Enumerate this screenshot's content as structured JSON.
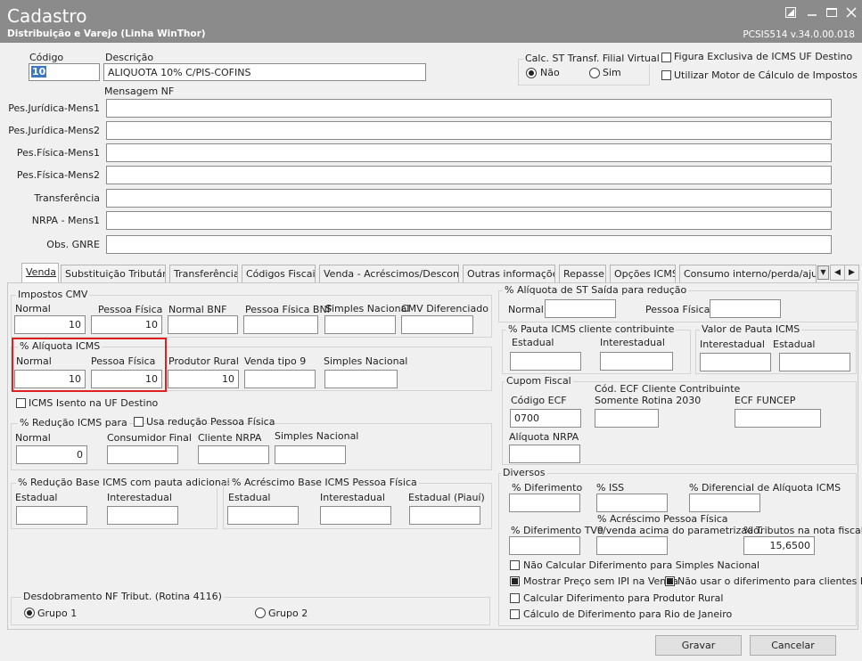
{
  "window": {
    "title": "Cadastro",
    "subtitle": "Distribuição e Varejo (Linha WinThor)",
    "version": "PCSIS514  v.34.0.00.018",
    "icons": [
      "restore-icon",
      "minimize-icon",
      "maximize-icon",
      "close-icon"
    ]
  },
  "header": {
    "codigo_label": "Código",
    "codigo_value": "10",
    "descricao_label": "Descrição",
    "descricao_value": "ALIQUOTA 10% C/PIS-COFINS",
    "mensagem_label": "Mensagem NF",
    "calc_st_title": "Calc. ST Transf. Filial Virtual",
    "calc_st_nao": "Não",
    "calc_st_sim": "Sim",
    "figura_exclusiva": "Figura Exclusiva de ICMS UF Destino",
    "utilizar_motor": "Utilizar Motor de Cálculo de Impostos"
  },
  "messages": [
    {
      "label": "Pes.Jurídica-Mens1",
      "value": ""
    },
    {
      "label": "Pes.Jurídica-Mens2",
      "value": ""
    },
    {
      "label": "Pes.Física-Mens1",
      "value": ""
    },
    {
      "label": "Pes.Física-Mens2",
      "value": ""
    },
    {
      "label": "Transferência",
      "value": ""
    },
    {
      "label": "NRPA - Mens1",
      "value": ""
    },
    {
      "label": "Obs. GNRE",
      "value": ""
    }
  ],
  "tabs": [
    "Venda",
    "Substituição Tributária",
    "Transferência",
    "Códigos Fiscais",
    "Venda - Acréscimos/Descontos",
    "Outras informações",
    "Repasse",
    "Opções ICMS",
    "Consumo interno/perda/ajuste"
  ],
  "impostos_cmv": {
    "title": "Impostos CMV",
    "normal_label": "Normal",
    "normal_value": "10",
    "pf_label": "Pessoa Física",
    "pf_value": "10",
    "bnf_label": "Normal BNF",
    "bnf_value": "",
    "pfbnf_label": "Pessoa Física BNF",
    "pfbnf_value": "",
    "simples_label": "Simples Nacional",
    "simples_value": "",
    "dif_label": "CMV Diferenciado",
    "dif_value": ""
  },
  "aliquota_icms": {
    "title": "% Alíquota ICMS",
    "normal_label": "Normal",
    "normal_value": "10",
    "pf_label": "Pessoa Física",
    "pf_value": "10",
    "produtor_label": "Produtor Rural",
    "produtor_value": "10",
    "venda9_label": "Venda tipo 9",
    "venda9_value": "",
    "simples_label": "Simples Nacional",
    "simples_value": ""
  },
  "icms_isento": "ICMS Isento na UF Destino",
  "reducao_icms": {
    "title": "% Redução ICMS para",
    "usa_reducao": "Usa redução Pessoa Física",
    "normal_label": "Normal",
    "normal_value": "0",
    "consumidor_label": "Consumidor Final",
    "consumidor_value": "",
    "nrpa_label": "Cliente NRPA",
    "nrpa_value": "",
    "simples_label": "Simples Nacional",
    "simples_value": ""
  },
  "reducao_base": {
    "title": "% Redução Base ICMS com pauta adicionais",
    "estadual_label": "Estadual",
    "interestadual_label": "Interestadual"
  },
  "acrescimo_base": {
    "title": "% Acréscimo Base ICMS Pessoa Física",
    "estadual_label": "Estadual",
    "interestadual_label": "Interestadual",
    "piaui_label": "Estadual (Piauí)"
  },
  "desdobramento": {
    "title": "Desdobramento NF Tribut. (Rotina 4116)",
    "grupo1": "Grupo 1",
    "grupo2": "Grupo 2"
  },
  "aliquota_st": {
    "title": "% Alíquota de ST Saída para redução",
    "normal_label": "Normal",
    "pf_label": "Pessoa Física"
  },
  "pauta_icms": {
    "title": "% Pauta ICMS cliente contribuinte",
    "estadual_label": "Estadual",
    "interestadual_label": "Interestadual"
  },
  "valor_pauta": {
    "title": "Valor de Pauta ICMS",
    "interestadual_label": "Interestadual",
    "estadual_label": "Estadual"
  },
  "cupom_fiscal": {
    "title": "Cupom Fiscal",
    "codigo_ecf_label": "Código ECF",
    "codigo_ecf_value": "0700",
    "cod_ecf_cliente_label": "Cód. ECF Cliente Contribuinte",
    "somente_rotina_label": "Somente Rotina 2030",
    "ecf_funcep_label": "ECF FUNCEP",
    "aliquota_nrpa_label": "Alíquota NRPA"
  },
  "diversos": {
    "title": "Diversos",
    "diferimento_label": "% Diferimento",
    "iss_label": "% ISS",
    "dif_aliquota_label": "% Diferencial de Alíquota ICMS",
    "diferimento_tv9_label": "% Diferimento TV9",
    "acrescimo_pf_label1": "% Acréscimo Pessoa Física",
    "acrescimo_pf_label2": "c/venda acima do parametrizado.",
    "tributos_label": "% Tributos na nota fiscal",
    "tributos_value": "15,6500",
    "nao_calcular": "Não Calcular Diferimento para Simples Nacional",
    "mostrar_preco": "Mostrar Preço sem IPI na Venda",
    "nao_usar": "Não usar o diferimento para clientes MEI",
    "calcular_produtor": "Calcular Diferimento para Produtor Rural",
    "calculo_rj": "Cálculo de Diferimento para Rio de Janeiro"
  },
  "buttons": {
    "gravar": "Gravar",
    "cancelar": "Cancelar"
  },
  "colors": {
    "titlebar": "#8b8b8b",
    "highlight": "#e02020",
    "focus": "#3b78c4"
  }
}
